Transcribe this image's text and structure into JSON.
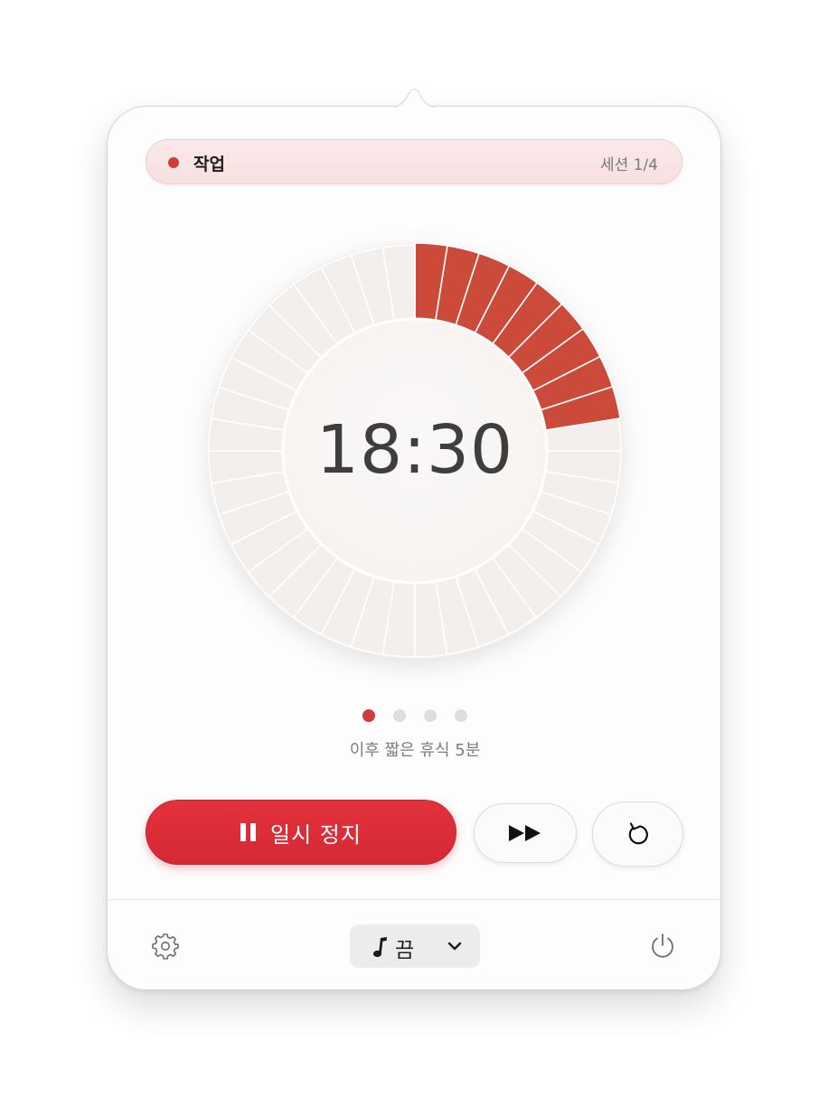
{
  "phase": {
    "label": "작업",
    "session": "세션 1/4",
    "dot_color": "#d23b3b"
  },
  "timer": {
    "time": "18:30",
    "progress_fraction": 0.225,
    "filled_color": "#cc4a3a",
    "empty_color": "#f2efed"
  },
  "sessions": {
    "total": 4,
    "current": 1
  },
  "next_up": "이후 짧은 휴식 5분",
  "controls": {
    "pause_label": "일시 정지",
    "pause_icon": "pause-icon",
    "skip_icon": "fast-forward-icon",
    "reset_icon": "restart-icon",
    "accent": "#dc2d37"
  },
  "footer": {
    "settings_icon": "gear-icon",
    "sound_icon": "music-note-icon",
    "sound_value": "끔",
    "sound_chevron": "chevron-down-icon",
    "power_icon": "power-icon"
  }
}
